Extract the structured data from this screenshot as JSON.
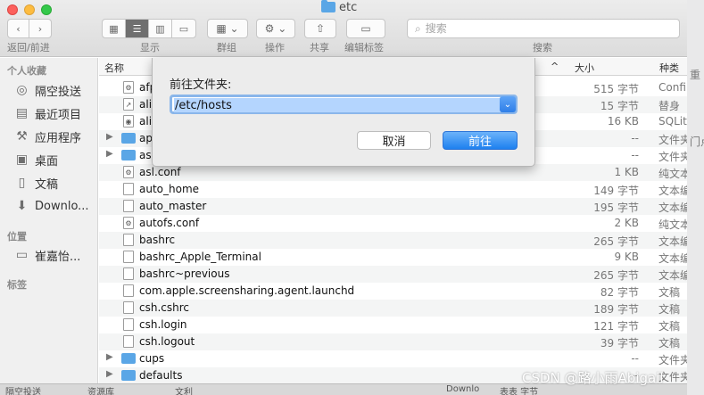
{
  "window": {
    "title": "etc"
  },
  "toolbar": {
    "back_forward_label": "返回/前进",
    "view_label": "显示",
    "group_label": "群组",
    "action_label": "操作",
    "share_label": "共享",
    "tags_label": "编辑标签",
    "search_label": "搜索",
    "search_placeholder": "搜索"
  },
  "sidebar": {
    "favorites_heading": "个人收藏",
    "favorites": [
      {
        "label": "隔空投送",
        "icon": "airdrop-icon"
      },
      {
        "label": "最近项目",
        "icon": "recents-icon"
      },
      {
        "label": "应用程序",
        "icon": "applications-icon"
      },
      {
        "label": "桌面",
        "icon": "desktop-icon"
      },
      {
        "label": "文稿",
        "icon": "documents-icon"
      },
      {
        "label": "Downlo...",
        "icon": "downloads-icon"
      }
    ],
    "locations_heading": "位置",
    "locations": [
      {
        "label": "崔嘉怡...",
        "icon": "computer-icon"
      }
    ],
    "tags_heading": "标签"
  },
  "list": {
    "columns": {
      "name": "名称",
      "size": "大小",
      "kind": "种类"
    },
    "rows": [
      {
        "name": "afp",
        "size": "515 字节",
        "kind": "Confi",
        "type": "file"
      },
      {
        "name": "ali",
        "size": "15 字节",
        "kind": "替身",
        "type": "file"
      },
      {
        "name": "ali",
        "size": "16 KB",
        "kind": "SQLit",
        "type": "file"
      },
      {
        "name": "ap",
        "size": "--",
        "kind": "文件夹",
        "type": "folder"
      },
      {
        "name": "asl",
        "size": "--",
        "kind": "文件夹",
        "type": "folder"
      },
      {
        "name": "asl.conf",
        "size": "1 KB",
        "kind": "纯文本",
        "type": "file"
      },
      {
        "name": "auto_home",
        "size": "149 字节",
        "kind": "文本编",
        "type": "file"
      },
      {
        "name": "auto_master",
        "size": "195 字节",
        "kind": "文本编",
        "type": "file"
      },
      {
        "name": "autofs.conf",
        "size": "2 KB",
        "kind": "纯文本",
        "type": "file"
      },
      {
        "name": "bashrc",
        "size": "265 字节",
        "kind": "文本编",
        "type": "file"
      },
      {
        "name": "bashrc_Apple_Terminal",
        "size": "9 KB",
        "kind": "文本编",
        "type": "file"
      },
      {
        "name": "bashrc~previous",
        "size": "265 字节",
        "kind": "文本编",
        "type": "file"
      },
      {
        "name": "com.apple.screensharing.agent.launchd",
        "size": "82 字节",
        "kind": "文稿",
        "type": "file"
      },
      {
        "name": "csh.cshrc",
        "size": "189 字节",
        "kind": "文稿",
        "type": "file"
      },
      {
        "name": "csh.login",
        "size": "121 字节",
        "kind": "文稿",
        "type": "file"
      },
      {
        "name": "csh.logout",
        "size": "39 字节",
        "kind": "文稿",
        "type": "file"
      },
      {
        "name": "cups",
        "size": "--",
        "kind": "文件夹",
        "type": "folder"
      },
      {
        "name": "defaults",
        "size": "--",
        "kind": "文件夹",
        "type": "folder"
      }
    ]
  },
  "dialog": {
    "label": "前往文件夹:",
    "path_value": "/etc/hosts",
    "cancel_label": "取消",
    "go_label": "前往"
  },
  "background": {
    "right_text_1": "重",
    "right_text_2": "门点",
    "bottom_left": "隔空投送",
    "bottom_mid": "资源库",
    "bottom_mid2": "文利",
    "bottom_right": "Downlo",
    "bottom_right2": "表表 字节"
  },
  "watermark": "CSDN @路小雨Abigail"
}
